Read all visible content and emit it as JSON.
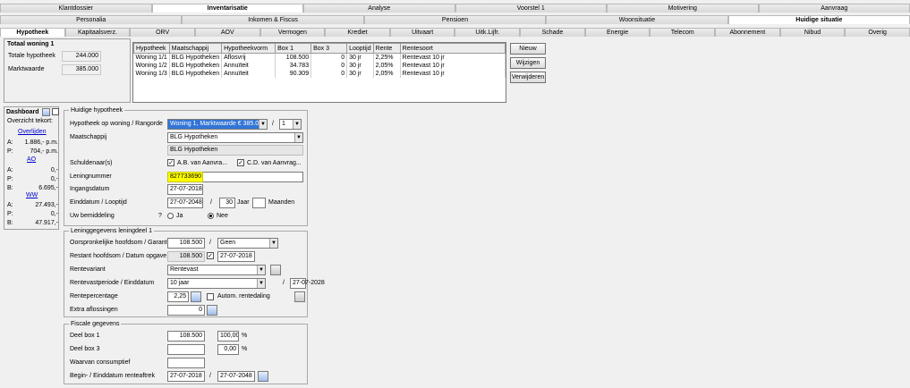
{
  "tabs_row1": [
    "Klantdossier",
    "Inventarisatie",
    "Analyse",
    "Voorstel 1",
    "Motivering",
    "Aanvraag"
  ],
  "tabs_row1_active": 1,
  "tabs_row2": [
    "Personalia",
    "Inkomen & Fiscus",
    "Pensioen",
    "Woonsituatie",
    "Huidige situatie"
  ],
  "tabs_row2_active": 4,
  "tabs_row3": [
    "Hypotheek",
    "Kapitaalsverz.",
    "ORV",
    "AOV",
    "Vermogen",
    "Krediet",
    "Uitvaart",
    "Uitk.Lijfr.",
    "Schade",
    "Energie",
    "Telecom",
    "Abonnement",
    "Nibud",
    "Overig"
  ],
  "tabs_row3_active": 0,
  "totaal": {
    "title": "Totaal woning 1",
    "hyp_label": "Totale hypotheek",
    "hyp_value": "244.000",
    "mw_label": "Marktwaarde",
    "mw_value": "385.000"
  },
  "grid": {
    "headers": [
      "Hypotheek",
      "Maatschappij",
      "Hypotheekvorm",
      "Box 1",
      "Box 3",
      "Looptijd",
      "Rente",
      "Rentesoort"
    ],
    "rows": [
      [
        "Woning 1/1",
        "BLG Hypotheken",
        "Aflosvrij",
        "108.500",
        "0",
        "30 jr",
        "2,25%",
        "Rentevast 10 jr"
      ],
      [
        "Woning 1/2",
        "BLG Hypotheken",
        "Annuïteit",
        "34.783",
        "0",
        "30 jr",
        "2,05%",
        "Rentevast 10 jr"
      ],
      [
        "Woning 1/3",
        "BLG Hypotheken",
        "Annuïteit",
        "90.309",
        "0",
        "30 jr",
        "2,05%",
        "Rentevast 10 jr"
      ]
    ]
  },
  "buttons": {
    "nieuw": "Nieuw",
    "wijzigen": "Wijzigen",
    "verwijderen": "Verwijderen"
  },
  "dashboard": {
    "title": "Dashboard",
    "overzicht": "Overzicht tekort:",
    "overlijden": "Overlijden",
    "ao": "AO",
    "ww": "WW",
    "block1": [
      [
        "A:",
        "1.886,- p.m."
      ],
      [
        "P:",
        "704,- p.m."
      ]
    ],
    "block2": [
      [
        "A:",
        "0,-"
      ],
      [
        "P:",
        "0,-"
      ],
      [
        "B:",
        "6.695,-"
      ]
    ],
    "block3": [
      [
        "A:",
        "27.493,-"
      ],
      [
        "P:",
        "0,-"
      ],
      [
        "B:",
        "47.917,-"
      ]
    ]
  },
  "huidige": {
    "title": "Huidige hypotheek",
    "hyp_woning_label": "Hypotheek op woning / Rangorde",
    "hyp_woning_value": "Woning 1, Marktwaarde € 385.00",
    "rangorde": "1",
    "maatschappij_label": "Maatschappij",
    "maatschappij_value": "BLG Hypotheken",
    "maatschappij_sub": "BLG Hypotheken",
    "schuldenaar_label": "Schuldenaar(s)",
    "schuldenaar1": "A.B. van Aanvra...",
    "schuldenaar2": "C.D. van Aanvrag...",
    "lening_label": "Leningnummer",
    "lening_value": "827733690",
    "ingang_label": "Ingangsdatum",
    "ingang_value": "27-07-2018",
    "eind_label": "Einddatum / Looptijd",
    "eind_value": "27-07-2048",
    "jaar_value": "30",
    "jaar_label": "Jaar",
    "maanden_label": "Maanden",
    "bemiddeling_label": "Uw bemiddeling",
    "q": "?",
    "ja": "Ja",
    "nee": "Nee"
  },
  "leningdeel": {
    "title": "Leninggegevens leningdeel 1",
    "oorspr_label": "Oorspronkelijke hoofdsom / Garantie",
    "oorspr_value": "108.500",
    "garantie": "Geen",
    "restant_label": "Restant hoofdsom / Datum opgave",
    "restant_value": "108.500",
    "restant_date": "27-07-2018",
    "variant_label": "Rentevariant",
    "variant_value": "Rentevast",
    "periode_label": "Rentevastperiode / Einddatum",
    "periode_value": "10 jaar",
    "periode_date": "27-07-2028",
    "perc_label": "Rentepercentage",
    "perc_value": "2,25",
    "autom_label": "Autom. rentedaling",
    "extra_label": "Extra aflossingen",
    "extra_value": "0"
  },
  "fiscaal": {
    "title": "Fiscale gegevens",
    "box1_label": "Deel box 1",
    "box1_value": "108.500",
    "box1_pct": "100,00",
    "box3_label": "Deel box 3",
    "box3_value": "",
    "box3_pct": "0,00",
    "pct": "%",
    "consump_label": "Waarvan consumptief",
    "renteaftrek_label": "Begin- / Einddatum renteaftrek",
    "begin": "27-07-2018",
    "eind": "27-07-2048"
  },
  "sep_slash": "/"
}
